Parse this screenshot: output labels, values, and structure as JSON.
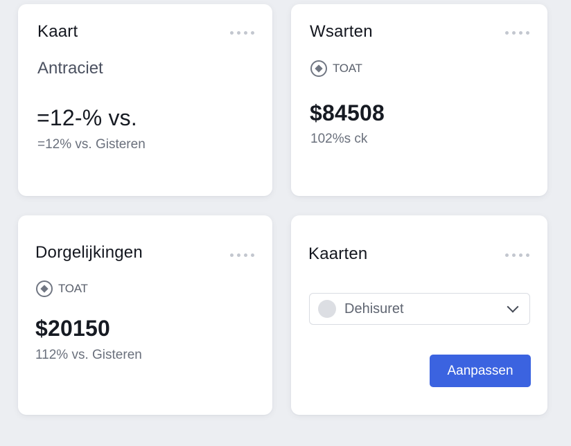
{
  "cards": {
    "kaart": {
      "title": "Kaart",
      "subtitle": "Antraciet",
      "value": "=12-% vs.",
      "caption": "=12% vs. Gisteren"
    },
    "waarden": {
      "title": "Wsarten",
      "tag_icon": "plus-circle-icon",
      "tag": "TOAT",
      "value": "$84508",
      "caption": "102%s ck"
    },
    "dorgelijkingen": {
      "title": "Dorgelijkingen",
      "tag_icon": "plus-circle-icon",
      "tag": "TOAT",
      "value": "$20150",
      "caption": "112% vs. Gisteren"
    },
    "kaarten": {
      "title": "Kaarten",
      "select": {
        "value": "Dehisuret",
        "icon": "chevron-down-icon"
      },
      "button_label": "Aanpassen"
    }
  },
  "menu_icon": "more-dots-icon",
  "colors": {
    "background": "#eceef2",
    "card": "#ffffff",
    "accent": "#3b63e0"
  }
}
